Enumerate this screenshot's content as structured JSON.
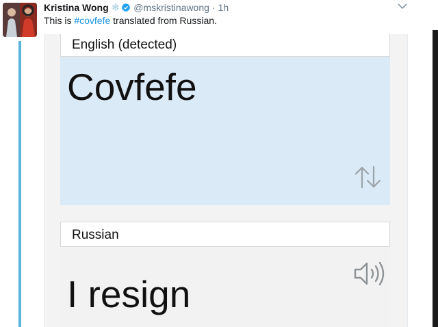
{
  "tweet": {
    "display_name": "Kristina Wong",
    "name_emoji": "snowflake-icon",
    "verified_icon": "verified-badge-icon",
    "handle": "@mskristinawong",
    "separator": "·",
    "time": "1h",
    "text_before": "This is ",
    "hashtag": "#covfefe",
    "text_after": " translated from Russian.",
    "menu_icon": "chevron-down-icon"
  },
  "translator": {
    "source_language": "English (detected)",
    "source_text": "Covfefe",
    "swap_icon": "swap-arrows-icon",
    "target_language": "Russian",
    "target_text": "I resign",
    "speaker_icon": "speaker-icon"
  },
  "colors": {
    "hashtag": "#1b95e0",
    "verified": "#1da1f2",
    "thread_line": "#5bb4de",
    "source_panel": "#dbeaf7"
  }
}
